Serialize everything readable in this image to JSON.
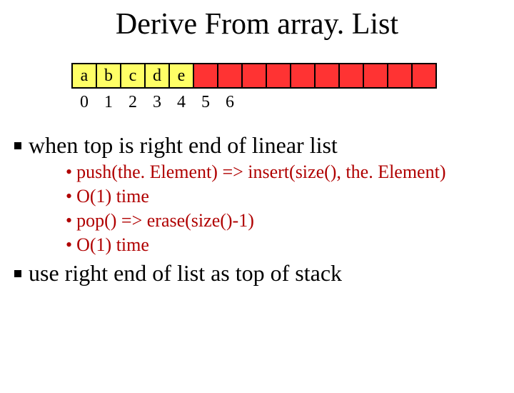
{
  "title": "Derive From array. List",
  "array": {
    "cells": [
      "a",
      "b",
      "c",
      "d",
      "e",
      "",
      "",
      "",
      "",
      "",
      "",
      "",
      "",
      "",
      ""
    ],
    "filled_count": 5,
    "indices": [
      "0",
      "1",
      "2",
      "3",
      "4",
      "5",
      "6"
    ]
  },
  "bullets": [
    {
      "text": "when top is right end of linear list",
      "sub": [
        "push(the. Element) => insert(size(), the. Element)",
        "O(1) time",
        "pop() => erase(size()-1)",
        "O(1) time"
      ]
    },
    {
      "text": "use right end of list as top of stack",
      "sub": []
    }
  ]
}
